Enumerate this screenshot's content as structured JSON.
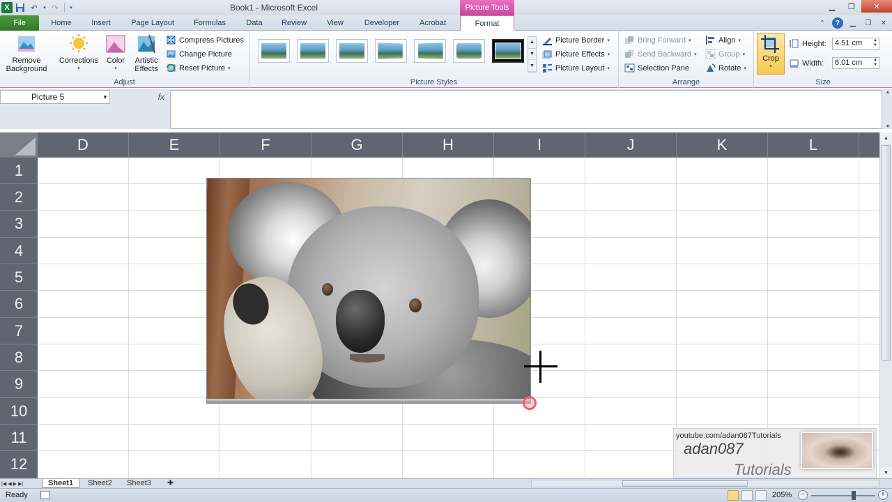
{
  "window": {
    "title": "Book1  -  Microsoft Excel",
    "contextual_group": "Picture Tools",
    "app_icon": "excel-logo-icon"
  },
  "tabs": [
    {
      "label": "File"
    },
    {
      "label": "Home"
    },
    {
      "label": "Insert"
    },
    {
      "label": "Page Layout"
    },
    {
      "label": "Formulas"
    },
    {
      "label": "Data"
    },
    {
      "label": "Review"
    },
    {
      "label": "View"
    },
    {
      "label": "Developer"
    },
    {
      "label": "Acrobat"
    },
    {
      "label": "Format"
    }
  ],
  "ribbon": {
    "adjust": {
      "label": "Adjust",
      "remove_background_1": "Remove",
      "remove_background_2": "Background",
      "corrections": "Corrections",
      "color": "Color",
      "artistic_1": "Artistic",
      "artistic_2": "Effects",
      "compress": "Compress Pictures",
      "change": "Change Picture",
      "reset": "Reset Picture"
    },
    "picture_styles": {
      "label": "Picture Styles",
      "border": "Picture Border",
      "effects": "Picture Effects",
      "layout": "Picture Layout"
    },
    "arrange": {
      "label": "Arrange",
      "bring_forward": "Bring Forward",
      "send_backward": "Send Backward",
      "selection_pane": "Selection Pane",
      "align": "Align",
      "group": "Group",
      "rotate": "Rotate"
    },
    "size": {
      "label": "Size",
      "crop": "Crop",
      "height_label": "Height:",
      "height_value": "4.51 cm",
      "width_label": "Width:",
      "width_value": "6.01 cm"
    }
  },
  "formula_bar": {
    "name_box": "Picture 5",
    "fx": "fx",
    "content": ""
  },
  "grid": {
    "columns": [
      "D",
      "E",
      "F",
      "G",
      "H",
      "I",
      "J",
      "K",
      "L"
    ],
    "rows": [
      "1",
      "2",
      "3",
      "4",
      "5",
      "6",
      "7",
      "8",
      "9",
      "10",
      "11",
      "12"
    ]
  },
  "watermark": {
    "url": "youtube.com/adan087Tutorials",
    "brand": "adan087",
    "sub": "Tutorials"
  },
  "sheets": [
    "Sheet1",
    "Sheet2",
    "Sheet3"
  ],
  "status": {
    "text": "Ready",
    "zoom": "205%"
  },
  "colors": {
    "file_tab": "#2f7a26",
    "contextual_accent": "#c8499e",
    "header_bg": "#5f6670"
  }
}
